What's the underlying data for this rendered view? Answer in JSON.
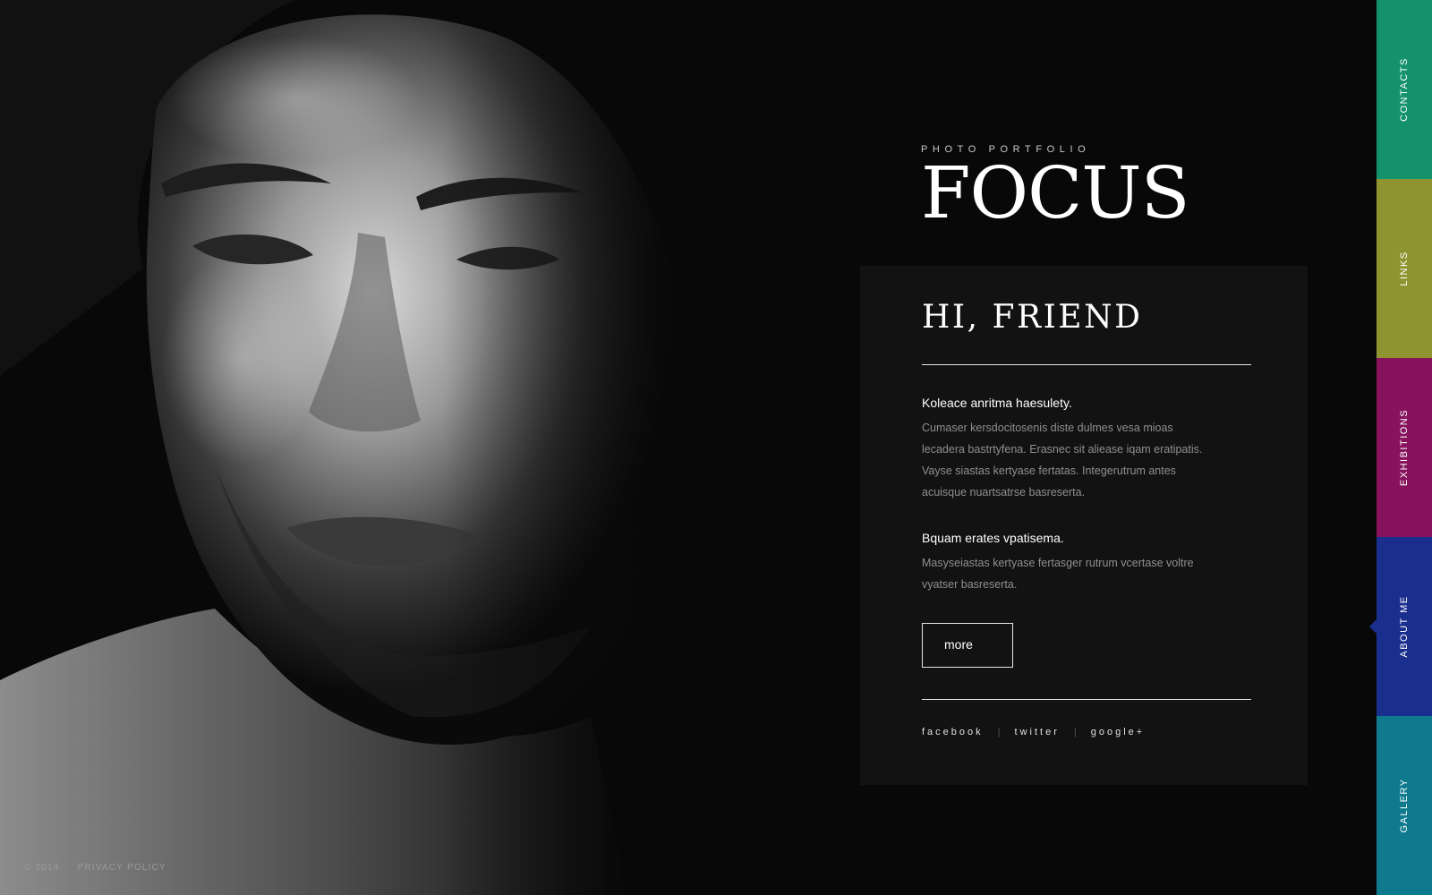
{
  "brand": {
    "subtitle": "PHOTO PORTFOLIO",
    "logo": "FOCUS"
  },
  "card": {
    "greeting": "HI, FRIEND",
    "blocks": [
      {
        "title": "Koleace anritma haesulety.",
        "text": "Cumaser kersdocitosenis diste dulmes vesa mioas lecadera bastrtyfena. Erasnec sit aliease iqam eratipatis. Vayse siastas kertyase fertatas. Integerutrum antes acuisque nuartsatrse basreserta."
      },
      {
        "title": "Bquam erates vpatisema.",
        "text": "Masyseiastas kertyase fertasger rutrum vcertase voltre vyatser basreserta."
      }
    ],
    "more_label": "more",
    "social": {
      "facebook": "facebook",
      "twitter": "twitter",
      "googleplus": "google+",
      "separator": "|"
    }
  },
  "footer": {
    "copyright": "© 2014",
    "privacy": "PRIVACY POLICY"
  },
  "nav": {
    "items": [
      {
        "label": "CONTACTS",
        "color": "#14926b"
      },
      {
        "label": "LINKS",
        "color": "#8e9530"
      },
      {
        "label": "EXHIBITIONS",
        "color": "#87135c"
      },
      {
        "label": "ABOUT ME",
        "color": "#1a2f8d",
        "active": true
      },
      {
        "label": "GALLERY",
        "color": "#0f7a8e"
      }
    ]
  },
  "colors": {
    "background": "#080808",
    "card": "#121212",
    "muted_text": "#8f8f8f"
  }
}
